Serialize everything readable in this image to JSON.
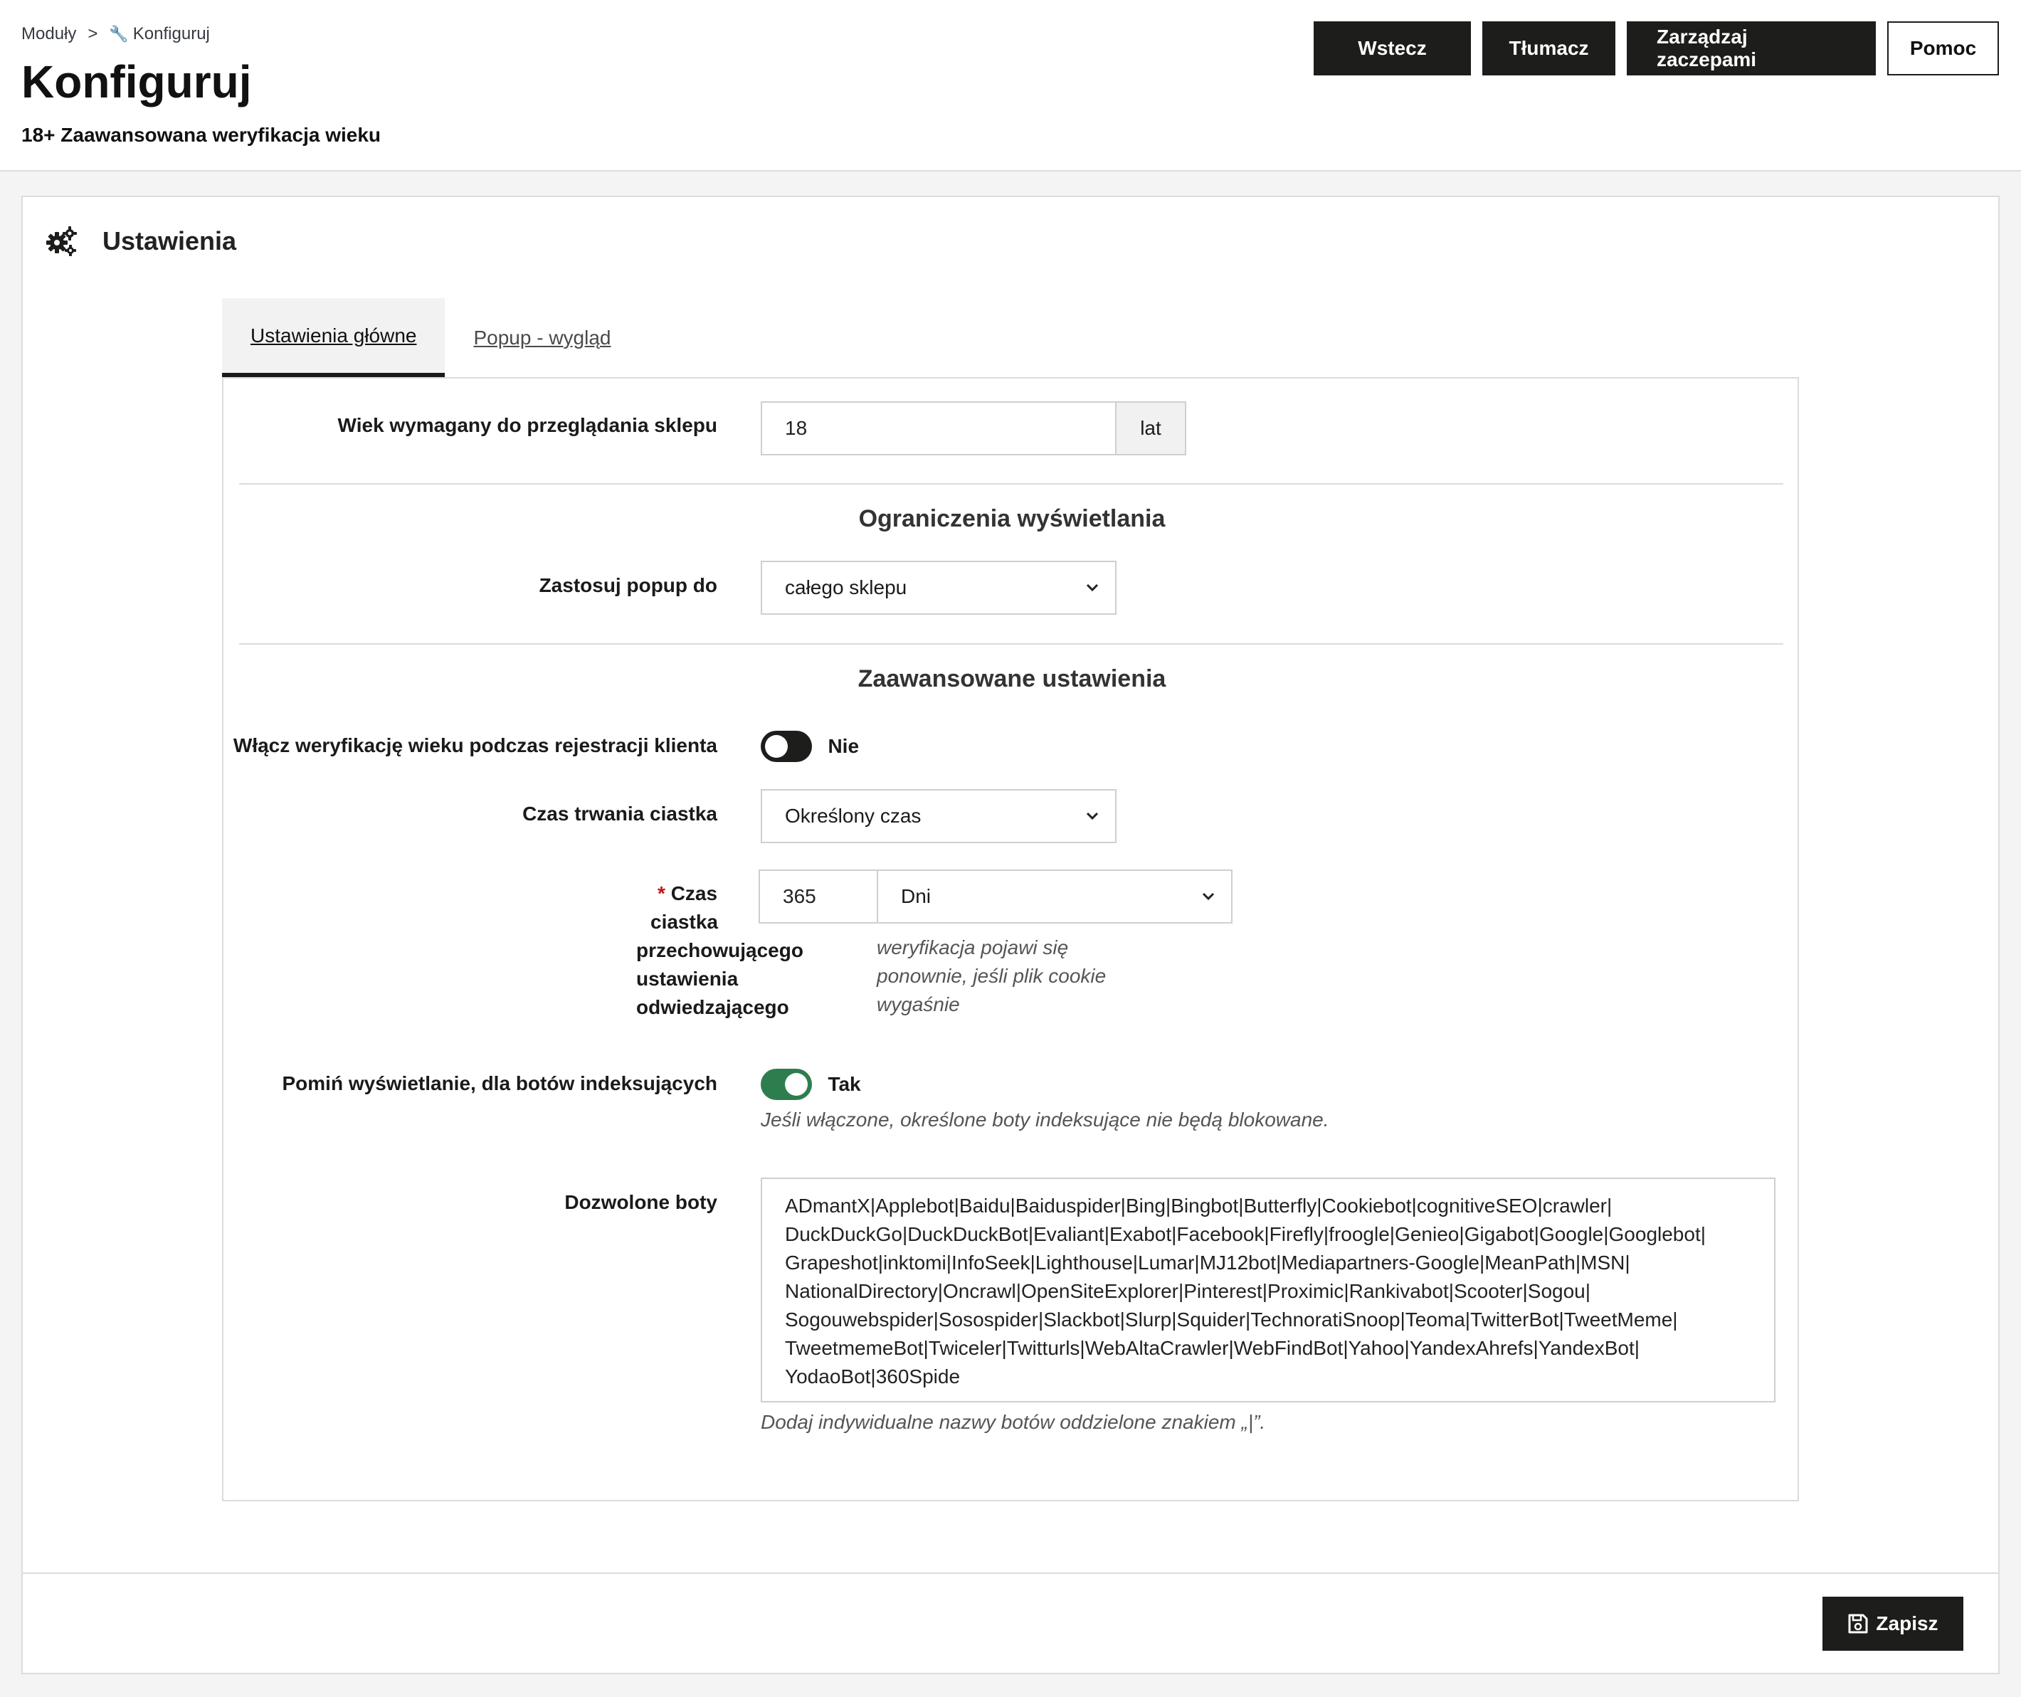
{
  "breadcrumb": {
    "parent": "Moduły",
    "separator": ">",
    "current": "Konfiguruj"
  },
  "header": {
    "title": "Konfiguruj",
    "subtitle": "18+ Zaawansowana weryfikacja wieku"
  },
  "toolbar": {
    "back": "Wstecz",
    "translate": "Tłumacz",
    "hooks": "Zarządzaj zaczepami",
    "help": "Pomoc"
  },
  "panel": {
    "title": "Ustawienia",
    "icon": "gears-icon"
  },
  "tabs": [
    {
      "label": "Ustawienia główne",
      "active": true
    },
    {
      "label": "Popup - wygląd",
      "active": false
    }
  ],
  "form": {
    "age": {
      "label": "Wiek wymagany do przeglądania sklepu",
      "value": "18",
      "suffix": "lat"
    },
    "section_display": "Ograniczenia wyświetlania",
    "apply_popup": {
      "label": "Zastosuj popup do",
      "value": "całego sklepu"
    },
    "section_advanced": "Zaawansowane ustawienia",
    "registration": {
      "label": "Włącz weryfikację wieku podczas rejestracji klienta",
      "state": "Nie",
      "on": false
    },
    "cookie_duration": {
      "label": "Czas trwania ciastka",
      "value": "Określony czas"
    },
    "cookie_time": {
      "required_mark": "*",
      "label_lines": [
        "Czas",
        "ciastka",
        "przechowującego",
        "ustawienia",
        "odwiedzającego"
      ],
      "value": "365",
      "unit": "Dni",
      "help_lines": [
        "weryfikacja pojawi się",
        "ponownie, jeśli plik cookie",
        "wygaśnie"
      ]
    },
    "skip_bots": {
      "label": "Pomiń wyświetlanie, dla botów indeksujących",
      "state": "Tak",
      "on": true,
      "help": "Jeśli włączone, określone boty indeksujące nie będą blokowane."
    },
    "allowed_bots": {
      "label": "Dozwolone boty",
      "lines": [
        "ADmantX|Applebot|Baidu|Baiduspider|Bing|Bingbot|Butterfly|Cookiebot|cognitiveSEO|crawler|",
        "DuckDuckGo|DuckDuckBot|Evaliant|Exabot|Facebook|Firefly|froogle|Genieo|Gigabot|Google|Googlebot|",
        "Grapeshot|inktomi|InfoSeek|Lighthouse|Lumar|MJ12bot|Mediapartners-Google|MeanPath|MSN|",
        "NationalDirectory|Oncrawl|OpenSiteExplorer|Pinterest|Proximic|Rankivabot|Scooter|Sogou|",
        "Sogouwebspider|Sosospider|Slackbot|Slurp|Squider|TechnoratiSnoop|Teoma|TwitterBot|TweetMeme|",
        "TweetmemeBot|Twiceler|Twitturls|WebAltaCrawler|WebFindBot|Yahoo|YandexAhrefs|YandexBot|",
        "YodaoBot|360Spide"
      ],
      "help": "Dodaj indywidualne nazwy botów oddzielone znakiem „|”."
    }
  },
  "footer": {
    "save": "Zapisz"
  },
  "colors": {
    "dark": "#1d1d1b",
    "toggle_on": "#2e7d4e",
    "required": "#c0161b"
  }
}
